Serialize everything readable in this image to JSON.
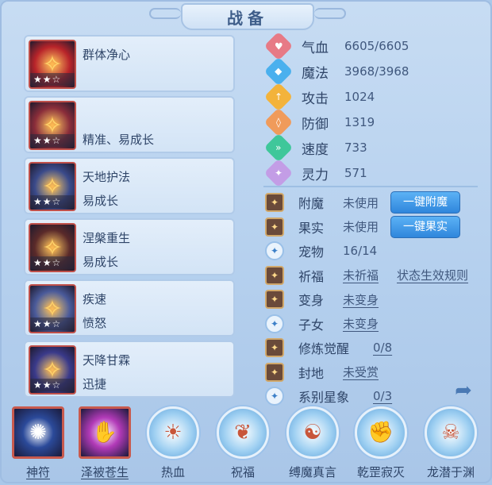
{
  "title": "战备",
  "skills": [
    {
      "name": "群体净心",
      "desc": "",
      "stars": "★★☆",
      "icon": "sword-icon",
      "color": "#b8242a"
    },
    {
      "name": "",
      "desc": "精准、易成长",
      "stars": "★★☆",
      "icon": "armor-icon",
      "color": "#8a2d3a"
    },
    {
      "name": "天地护法",
      "desc": "易成长",
      "stars": "★★☆",
      "icon": "totem-icon",
      "color": "#3a4a8a"
    },
    {
      "name": "涅槃重生",
      "desc": "易成长",
      "stars": "★★☆",
      "icon": "phoenix-icon",
      "color": "#5a2a2a"
    },
    {
      "name": "疾速",
      "desc": "愤怒",
      "stars": "★★☆",
      "icon": "ring-icon",
      "color": "#4a5a9a"
    },
    {
      "name": "天降甘霖",
      "desc": "迅捷",
      "stars": "★★☆",
      "icon": "rain-icon",
      "color": "#3a3a8a"
    }
  ],
  "stats": [
    {
      "label": "气血",
      "value": "6605/6605",
      "icon": "heart-icon",
      "color": "#e77a86",
      "glyph": "♥"
    },
    {
      "label": "魔法",
      "value": "3968/3968",
      "icon": "mana-icon",
      "color": "#4ab0ee",
      "glyph": "◆"
    },
    {
      "label": "攻击",
      "value": "1024",
      "icon": "attack-icon",
      "color": "#f3b33b",
      "glyph": "↑"
    },
    {
      "label": "防御",
      "value": "1319",
      "icon": "defense-icon",
      "color": "#f09b5b",
      "glyph": "◊"
    },
    {
      "label": "速度",
      "value": "733",
      "icon": "speed-icon",
      "color": "#3fc79a",
      "glyph": "»"
    },
    {
      "label": "灵力",
      "value": "571",
      "icon": "spirit-icon",
      "color": "#c39de6",
      "glyph": "✦"
    }
  ],
  "features": [
    {
      "label": "附魔",
      "value": "未使用",
      "button": "一键附魔",
      "icon": "enchant-icon"
    },
    {
      "label": "果实",
      "value": "未使用",
      "button": "一键果实",
      "icon": "fruit-icon"
    },
    {
      "label": "宠物",
      "value": "16/14",
      "icon": "pet-icon"
    },
    {
      "label": "祈福",
      "value": "未祈福",
      "link": "状态生效规则",
      "icon": "pray-icon"
    },
    {
      "label": "变身",
      "value": "未变身",
      "icon": "transform-icon"
    },
    {
      "label": "子女",
      "value": "未变身",
      "icon": "child-icon"
    },
    {
      "label": "修炼觉醒",
      "value": "0/8",
      "icon": "awaken-icon"
    },
    {
      "label": "封地",
      "value": "未受赏",
      "icon": "fief-icon"
    },
    {
      "label": "系别星象",
      "value": "0/3",
      "icon": "star-icon"
    }
  ],
  "bottom": [
    {
      "label": "神符",
      "icon": "talisman-icon",
      "color": "#2b4a9a",
      "glyph": "✺"
    },
    {
      "label": "泽被苍生",
      "icon": "palm-icon",
      "color": "#b23ab8",
      "glyph": "✋"
    },
    {
      "label": "热血",
      "icon": "blood-icon",
      "color": "#cfe6f8",
      "glyph": "☀"
    },
    {
      "label": "祝福",
      "icon": "bless-icon",
      "color": "#cfe6f8",
      "glyph": "❦"
    },
    {
      "label": "缚魔真言",
      "icon": "demon-icon",
      "color": "#cfe6f8",
      "glyph": "☯"
    },
    {
      "label": "乾罡寂灭",
      "icon": "fist-icon",
      "color": "#cfe6f8",
      "glyph": "✊"
    },
    {
      "label": "龙潜于渊",
      "icon": "dragon-icon",
      "color": "#cfe6f8",
      "glyph": "☠"
    }
  ]
}
